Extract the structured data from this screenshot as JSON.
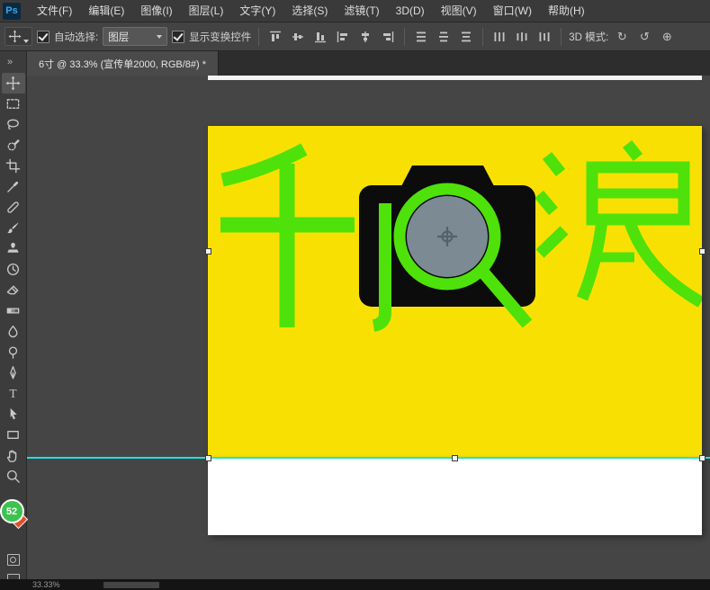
{
  "colors": {
    "canvas_yellow": "#F8E102",
    "logo_green": "#4FE10A",
    "lens_gray": "#7C8A94",
    "camera_black": "#0C0C0C",
    "guide_cyan": "#20E0DD",
    "ui_dark_gray": "#3C3C3C"
  },
  "menu": {
    "logo": "Ps",
    "items": [
      {
        "label": "文件(F)"
      },
      {
        "label": "编辑(E)"
      },
      {
        "label": "图像(I)"
      },
      {
        "label": "图层(L)"
      },
      {
        "label": "文字(Y)"
      },
      {
        "label": "选择(S)"
      },
      {
        "label": "滤镜(T)"
      },
      {
        "label": "3D(D)"
      },
      {
        "label": "视图(V)"
      },
      {
        "label": "窗口(W)"
      },
      {
        "label": "帮助(H)"
      }
    ]
  },
  "options": {
    "auto_select_label": "自动选择:",
    "auto_select_checked": true,
    "target_value": "图层",
    "show_transform_label": "显示变换控件",
    "show_transform_checked": true,
    "mode3d_label": "3D 模式:"
  },
  "icons": {
    "collapse_glyph": "»",
    "rotate3d": "↻",
    "roll3d": "↺",
    "pan3d": "⊕"
  },
  "tabs": [
    {
      "label": "6寸 @ 33.3% (宣传单2000, RGB/8#) *",
      "active": true
    }
  ],
  "toolbar": {
    "fg_badge": "52"
  },
  "document": {
    "logo_left_char": "千",
    "logo_right_char": "浪",
    "zoom": "33.33%"
  },
  "status": {
    "zoom": "33.33%"
  }
}
